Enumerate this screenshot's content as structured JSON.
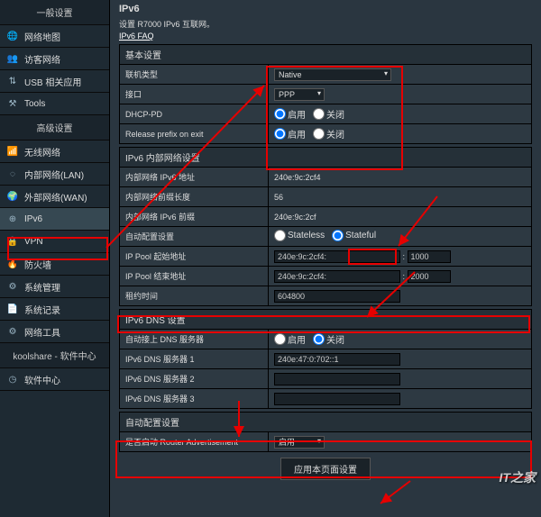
{
  "sidebar": {
    "group1_title": "一般设置",
    "group1": [
      {
        "label": "网络地图"
      },
      {
        "label": "访客网络"
      },
      {
        "label": "USB 相关应用"
      },
      {
        "label": "Tools"
      }
    ],
    "group2_title": "高级设置",
    "group2": [
      {
        "label": "无线网络"
      },
      {
        "label": "内部网络(LAN)"
      },
      {
        "label": "外部网络(WAN)"
      },
      {
        "label": "IPv6"
      },
      {
        "label": "VPN"
      },
      {
        "label": "防火墙"
      },
      {
        "label": "系统管理"
      },
      {
        "label": "系统记录"
      },
      {
        "label": "网络工具"
      }
    ],
    "group3_title": "koolshare - 软件中心",
    "group3": [
      {
        "label": "软件中心"
      }
    ]
  },
  "page": {
    "title": "IPv6",
    "desc": "设置 R7000 IPv6 互联网。",
    "faq": "IPv6 FAQ"
  },
  "sections": {
    "basic": "基本设置",
    "lan": "IPv6 内部网络设置",
    "dns": "IPv6 DNS 设置",
    "auto": "自动配置设置"
  },
  "basic": {
    "conn_type_label": "联机类型",
    "conn_type_value": "Native",
    "iface_label": "接口",
    "iface_value": "PPP",
    "dhcp_pd_label": "DHCP-PD",
    "release_label": "Release prefix on exit",
    "opt_enable": "启用",
    "opt_disable": "关闭"
  },
  "lan": {
    "addr_label": "内部网络 IPv6 地址",
    "addr_value": "240e:9c:2cf4",
    "plen_label": "内部网络前缀长度",
    "plen_value": "56",
    "prefix_label": "内部网络 IPv6 前缀",
    "prefix_value": "240e:9c:2cf",
    "auto_label": "自动配置设置",
    "opt_stateless": "Stateless",
    "opt_stateful": "Stateful",
    "pool_start_label": "IP Pool 起始地址",
    "pool_start_prefix": "240e:9c:2cf4:",
    "pool_start_suffix": "1000",
    "pool_end_label": "IP Pool 结束地址",
    "pool_end_prefix": "240e:9c:2cf4:",
    "pool_end_suffix": "2000",
    "lease_label": "租约时间",
    "lease_value": "604800"
  },
  "dns": {
    "auto_label": "自动接上 DNS 服务器",
    "srv1_label": "IPv6 DNS 服务器 1",
    "srv1_value": "240e:47:0:702::1",
    "srv2_label": "IPv6 DNS 服务器 2",
    "srv3_label": "IPv6 DNS 服务器 3"
  },
  "auto": {
    "ra_label": "是否启动 Router Advertisement",
    "ra_value": "启用"
  },
  "apply": "应用本页面设置",
  "watermark": "IT之家"
}
